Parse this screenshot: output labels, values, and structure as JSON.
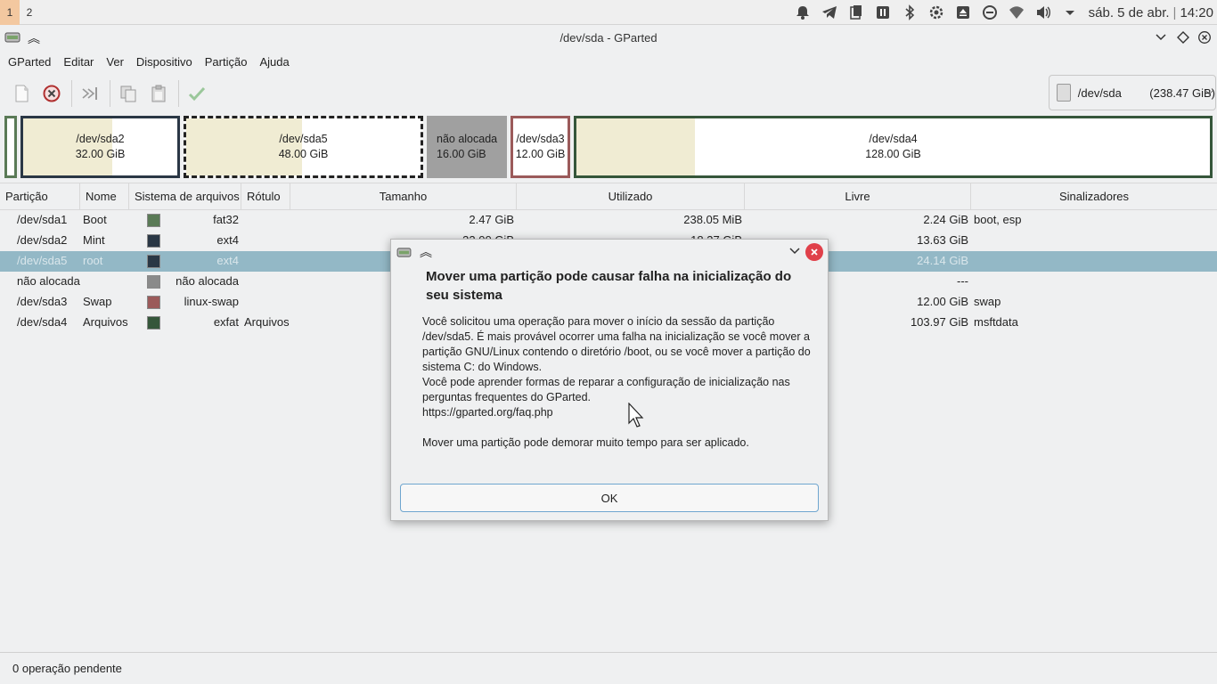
{
  "panel": {
    "workspaces": [
      "1",
      "2"
    ],
    "clock_date": "sáb. 5 de abr.",
    "clock_sep": "|",
    "clock_time": "14:20",
    "tray_icons": [
      "notifications-icon",
      "telegram-icon",
      "clipboard-icon",
      "media-pause-icon",
      "bluetooth-icon",
      "settings-icon",
      "eject-icon",
      "do-not-disturb-icon",
      "wifi-icon",
      "volume-icon",
      "menu-down-icon"
    ]
  },
  "window": {
    "title": "/dev/sda - GParted"
  },
  "menu": [
    "GParted",
    "Editar",
    "Ver",
    "Dispositivo",
    "Partição",
    "Ajuda"
  ],
  "device": {
    "name": "/dev/sda",
    "size": "(238.47 GiB)"
  },
  "diskmap": [
    {
      "name": "/dev/sda2",
      "size": "32.00 GiB",
      "border": "#2a3745"
    },
    {
      "name": "/dev/sda5",
      "size": "48.00 GiB",
      "border": "#2a3745"
    },
    {
      "name": "não alocada",
      "size": "16.00 GiB",
      "border": "#9a9a9a"
    },
    {
      "name": "/dev/sda3",
      "size": "12.00 GiB",
      "border": "#9b5a5a"
    },
    {
      "name": "/dev/sda4",
      "size": "128.00 GiB",
      "border": "#35563a"
    }
  ],
  "table": {
    "headers": [
      "Partição",
      "Nome",
      "Sistema de arquivos",
      "Rótulo",
      "Tamanho",
      "Utilizado",
      "Livre",
      "Sinalizadores"
    ],
    "rows": [
      {
        "part": "/dev/sda1",
        "name": "Boot",
        "fs": "fat32",
        "label": "",
        "size": "2.47 GiB",
        "used": "238.05 MiB",
        "free": "2.24 GiB",
        "flags": "boot, esp",
        "color": "#5a7a56"
      },
      {
        "part": "/dev/sda2",
        "name": "Mint",
        "fs": "ext4",
        "label": "",
        "size": "32.00 GiB",
        "used": "18.37 GiB",
        "free": "13.63 GiB",
        "flags": "",
        "color": "#2a3745"
      },
      {
        "part": "/dev/sda5",
        "name": "root",
        "fs": "ext4",
        "label": "",
        "size": "",
        "used": "",
        "free": "24.14 GiB",
        "flags": "",
        "color": "#2a3745"
      },
      {
        "part": "não alocada",
        "name": "",
        "fs": "não alocada",
        "label": "",
        "size": "",
        "used": "",
        "free": "---",
        "flags": "",
        "color": "#8a8a8a"
      },
      {
        "part": "/dev/sda3",
        "name": "Swap",
        "fs": "linux-swap",
        "label": "",
        "size": "",
        "used": "",
        "free": "12.00 GiB",
        "flags": "swap",
        "color": "#9b5a5a"
      },
      {
        "part": "/dev/sda4",
        "name": "Arquivos",
        "fs": "exfat",
        "label": "Arquivos",
        "size": "",
        "used": "",
        "free": "103.97 GiB",
        "flags": "msftdata",
        "color": "#35563a"
      }
    ]
  },
  "status": "0 operação pendente",
  "dialog": {
    "heading": "Mover uma partição pode causar falha na inicialização do seu sistema",
    "p1": "Você solicitou uma operação para mover o início da sessão da partição /dev/sda5.  É mais provável ocorrer uma falha na inicialização se você mover a partição GNU/Linux contendo o diretório /boot, ou se você mover a partição do sistema C: do Windows.",
    "p2": "Você pode aprender formas de reparar a configuração de inicialização nas perguntas frequentes do GParted.",
    "link": "https://gparted.org/faq.php",
    "p3": "Mover uma partição pode demorar muito tempo para ser aplicado.",
    "ok_label": "OK"
  }
}
